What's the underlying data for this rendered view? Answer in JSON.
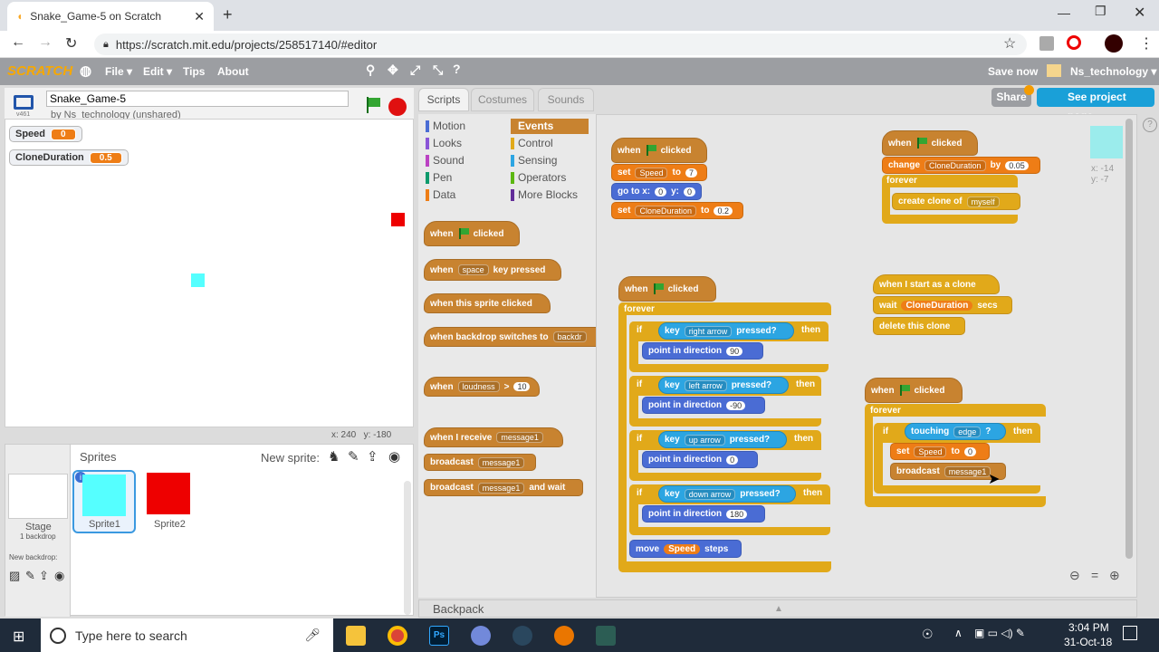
{
  "browser": {
    "tab_title": "Snake_Game-5 on Scratch",
    "url": "https://scratch.mit.edu/projects/258517140/#editor"
  },
  "menu": {
    "logo": "SCRATCH",
    "file": "File ▾",
    "edit": "Edit ▾",
    "tips": "Tips",
    "about": "About",
    "save_now": "Save now",
    "user": "Ns_technology ▾"
  },
  "project": {
    "title": "Snake_Game-5",
    "author": "by Ns_technology (unshared)",
    "version": "v461",
    "share": "Share",
    "see_page": "See project page"
  },
  "tabs": {
    "scripts": "Scripts",
    "costumes": "Costumes",
    "sounds": "Sounds"
  },
  "monitors": [
    {
      "label": "Speed",
      "value": "0"
    },
    {
      "label": "CloneDuration",
      "value": "0.5"
    }
  ],
  "stage_coords": {
    "x": "x: 240",
    "y": "y: -180"
  },
  "sprite_coords": {
    "x": "x: -14",
    "y": "y: -7"
  },
  "categories": {
    "motion": "Motion",
    "looks": "Looks",
    "sound": "Sound",
    "pen": "Pen",
    "data": "Data",
    "events": "Events",
    "control": "Control",
    "sensing": "Sensing",
    "operators": "Operators",
    "more": "More Blocks"
  },
  "palette": {
    "p1": [
      "when",
      "clicked"
    ],
    "p2": [
      "when",
      "space",
      "key pressed"
    ],
    "p3": "when this sprite clicked",
    "p4": [
      "when backdrop switches to",
      "backdr"
    ],
    "p5": [
      "when",
      "loudness",
      ">",
      "10"
    ],
    "p6": [
      "when I receive",
      "message1"
    ],
    "p7": [
      "broadcast",
      "message1"
    ],
    "p8": [
      "broadcast",
      "message1",
      "and wait"
    ]
  },
  "scripts": {
    "s1": {
      "hat": [
        "when",
        "clicked"
      ],
      "set1": [
        "set",
        "Speed",
        "to",
        "7"
      ],
      "goto": [
        "go to x:",
        "0",
        "y:",
        "0"
      ],
      "set2": [
        "set",
        "CloneDuration",
        "to",
        "0.2"
      ]
    },
    "s2": {
      "hat": [
        "when",
        "clicked"
      ],
      "change": [
        "change",
        "CloneDuration",
        "by",
        "0.05"
      ],
      "forever": "forever",
      "clone": [
        "create clone of",
        "myself"
      ]
    },
    "s3": {
      "hat": [
        "when",
        "clicked"
      ],
      "forever": "forever",
      "ifs": [
        {
          "if": "if",
          "key": "key",
          "dir": "right arrow",
          "pressed": "pressed?",
          "then": "then",
          "point": "point in direction",
          "deg": "90"
        },
        {
          "if": "if",
          "key": "key",
          "dir": "left arrow",
          "pressed": "pressed?",
          "then": "then",
          "point": "point in direction",
          "deg": "-90"
        },
        {
          "if": "if",
          "key": "key",
          "dir": "up arrow",
          "pressed": "pressed?",
          "then": "then",
          "point": "point in direction",
          "deg": "0"
        },
        {
          "if": "if",
          "key": "key",
          "dir": "down arrow",
          "pressed": "pressed?",
          "then": "then",
          "point": "point in direction",
          "deg": "180"
        }
      ],
      "move": [
        "move",
        "Speed",
        "steps"
      ]
    },
    "s4": {
      "hat": "when I start as a clone",
      "wait": [
        "wait",
        "CloneDuration",
        "secs"
      ],
      "del": "delete this clone"
    },
    "s5": {
      "hat": [
        "when",
        "clicked"
      ],
      "forever": "forever",
      "if": "if",
      "touching": [
        "touching",
        "edge",
        "?",
        "then"
      ],
      "set": [
        "set",
        "Speed",
        "to",
        "0"
      ],
      "broadcast": [
        "broadcast",
        "message1"
      ]
    }
  },
  "sprites": {
    "header": "Sprites",
    "new_sprite": "New sprite:",
    "stage": "Stage",
    "backdrops": "1 backdrop",
    "new_backdrop": "New backdrop:",
    "items": [
      "Sprite1",
      "Sprite2"
    ]
  },
  "backpack": "Backpack",
  "taskbar": {
    "search": "Type here to search",
    "time": "3:04 PM",
    "date": "31-Oct-18"
  },
  "colors": {
    "sprite1": "#5ff",
    "sprite2": "#e00",
    "events": "#c88330"
  }
}
